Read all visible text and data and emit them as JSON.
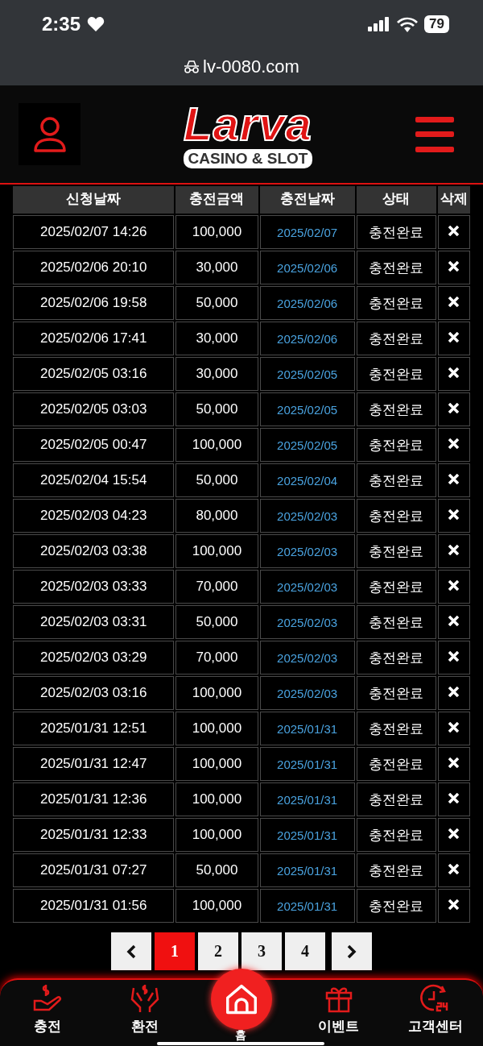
{
  "status_bar": {
    "time": "2:35",
    "battery": "79"
  },
  "browser": {
    "url": "lv-0080.com"
  },
  "header": {
    "logo_title": "Larva",
    "logo_subtitle": "CASINO & SLOT"
  },
  "table": {
    "columns": [
      "신청날짜",
      "충전금액",
      "충전날짜",
      "상태",
      "삭제"
    ],
    "rows": [
      {
        "requested": "2025/02/07 14:26",
        "amount": "100,000",
        "date": "2025/02/07",
        "status": "충전완료"
      },
      {
        "requested": "2025/02/06 20:10",
        "amount": "30,000",
        "date": "2025/02/06",
        "status": "충전완료"
      },
      {
        "requested": "2025/02/06 19:58",
        "amount": "50,000",
        "date": "2025/02/06",
        "status": "충전완료"
      },
      {
        "requested": "2025/02/06 17:41",
        "amount": "30,000",
        "date": "2025/02/06",
        "status": "충전완료"
      },
      {
        "requested": "2025/02/05 03:16",
        "amount": "30,000",
        "date": "2025/02/05",
        "status": "충전완료"
      },
      {
        "requested": "2025/02/05 03:03",
        "amount": "50,000",
        "date": "2025/02/05",
        "status": "충전완료"
      },
      {
        "requested": "2025/02/05 00:47",
        "amount": "100,000",
        "date": "2025/02/05",
        "status": "충전완료"
      },
      {
        "requested": "2025/02/04 15:54",
        "amount": "50,000",
        "date": "2025/02/04",
        "status": "충전완료"
      },
      {
        "requested": "2025/02/03 04:23",
        "amount": "80,000",
        "date": "2025/02/03",
        "status": "충전완료"
      },
      {
        "requested": "2025/02/03 03:38",
        "amount": "100,000",
        "date": "2025/02/03",
        "status": "충전완료"
      },
      {
        "requested": "2025/02/03 03:33",
        "amount": "70,000",
        "date": "2025/02/03",
        "status": "충전완료"
      },
      {
        "requested": "2025/02/03 03:31",
        "amount": "50,000",
        "date": "2025/02/03",
        "status": "충전완료"
      },
      {
        "requested": "2025/02/03 03:29",
        "amount": "70,000",
        "date": "2025/02/03",
        "status": "충전완료"
      },
      {
        "requested": "2025/02/03 03:16",
        "amount": "100,000",
        "date": "2025/02/03",
        "status": "충전완료"
      },
      {
        "requested": "2025/01/31 12:51",
        "amount": "100,000",
        "date": "2025/01/31",
        "status": "충전완료"
      },
      {
        "requested": "2025/01/31 12:47",
        "amount": "100,000",
        "date": "2025/01/31",
        "status": "충전완료"
      },
      {
        "requested": "2025/01/31 12:36",
        "amount": "100,000",
        "date": "2025/01/31",
        "status": "충전완료"
      },
      {
        "requested": "2025/01/31 12:33",
        "amount": "100,000",
        "date": "2025/01/31",
        "status": "충전완료"
      },
      {
        "requested": "2025/01/31 07:27",
        "amount": "50,000",
        "date": "2025/01/31",
        "status": "충전완료"
      },
      {
        "requested": "2025/01/31 01:56",
        "amount": "100,000",
        "date": "2025/01/31",
        "status": "충전완료"
      }
    ]
  },
  "pagination": {
    "pages": [
      {
        "label": "1",
        "selected": true
      },
      {
        "label": "2",
        "selected": false
      },
      {
        "label": "3",
        "selected": false
      },
      {
        "label": "4",
        "selected": false
      }
    ]
  },
  "bottom_nav": [
    {
      "kind": "deposit",
      "label": "충전"
    },
    {
      "kind": "exchange",
      "label": "환전"
    },
    {
      "kind": "home",
      "label": "홈"
    },
    {
      "kind": "event",
      "label": "이벤트"
    },
    {
      "kind": "support",
      "label": "고객센터"
    }
  ]
}
